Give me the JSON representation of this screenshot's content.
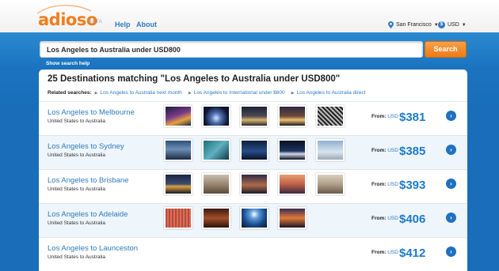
{
  "header": {
    "logo": "adioso",
    "beta": "BETA",
    "nav": {
      "help": "Help",
      "about": "About"
    },
    "location": "San Francisco",
    "currency": "USD"
  },
  "search": {
    "query": "Los Angeles to Australia under USD800",
    "button": "Search",
    "help_link": "Show search help"
  },
  "results": {
    "title": "25 Destinations matching \"Los Angeles to Australia under USD800\"",
    "related_label": "Related searches:",
    "related": [
      "Los Angeles to Australia next month",
      "Los Angeles to International under $600",
      "Los Angeles to Australia direct"
    ],
    "from_label": "From:",
    "currency": "USD",
    "rows": [
      {
        "title": "Los Angeles to Melbourne",
        "subtitle": "United States to Australia",
        "price": "$381"
      },
      {
        "title": "Los Angeles to Sydney",
        "subtitle": "United States to Australia",
        "price": "$385"
      },
      {
        "title": "Los Angeles to Brisbane",
        "subtitle": "United States to Australia",
        "price": "$393"
      },
      {
        "title": "Los Angeles to Adelaide",
        "subtitle": "United States to Australia",
        "price": "$406"
      },
      {
        "title": "Los Angeles to Launceston",
        "subtitle": "United States to Australia",
        "price": "$412"
      }
    ]
  },
  "colors": {
    "brand_orange": "#f07d1d",
    "brand_blue": "#1a6db8",
    "link_blue": "#2f7bbf"
  }
}
